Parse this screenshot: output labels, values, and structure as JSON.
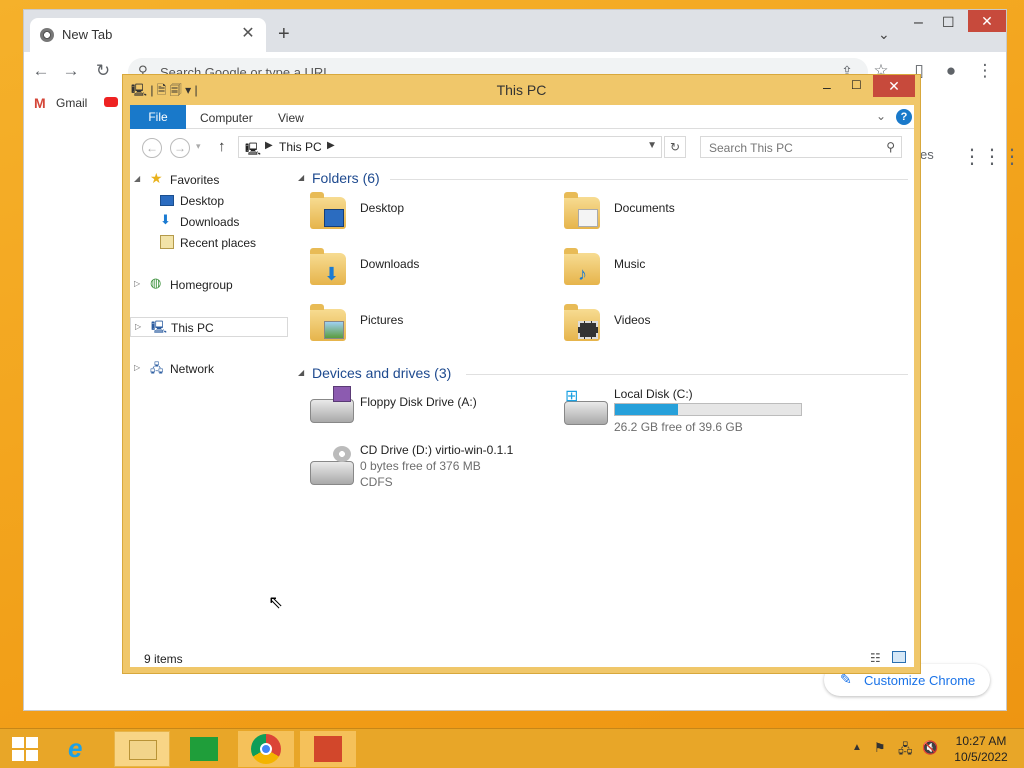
{
  "chrome": {
    "tab_title": "New Tab",
    "omnibox_placeholder": "Search Google or type a URL",
    "bookmarks": [
      {
        "label": "Gmail"
      }
    ],
    "ntp_right_text": "es",
    "customize_label": "Customize Chrome"
  },
  "explorer": {
    "title": "This PC",
    "ribbon_tabs": [
      "File",
      "Computer",
      "View"
    ],
    "address": "This PC",
    "search_placeholder": "Search This PC",
    "nav": {
      "favorites": "Favorites",
      "favorites_items": [
        "Desktop",
        "Downloads",
        "Recent places"
      ],
      "homegroup": "Homegroup",
      "this_pc": "This PC",
      "network": "Network"
    },
    "folders_header": "Folders (6)",
    "folders": [
      "Desktop",
      "Documents",
      "Downloads",
      "Music",
      "Pictures",
      "Videos"
    ],
    "devices_header": "Devices and drives (3)",
    "drives": {
      "floppy": {
        "name": "Floppy Disk Drive (A:)"
      },
      "c": {
        "name": "Local Disk (C:)",
        "free": "26.2 GB free of 39.6 GB",
        "used_fraction": 0.34
      },
      "d": {
        "name": "CD Drive (D:) virtio-win-0.1.1",
        "free": "0 bytes free of 376 MB",
        "fs": "CDFS"
      }
    },
    "status": "9 items"
  },
  "taskbar": {
    "time": "10:27 AM",
    "date": "10/5/2022"
  },
  "colors": {
    "accent": "#1979ca",
    "desktop": "#f2a421",
    "close": "#c74a3c",
    "drive_bar": "#26a0da"
  }
}
